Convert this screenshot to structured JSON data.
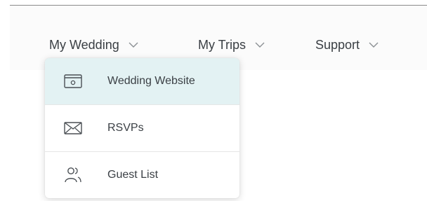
{
  "nav": {
    "items": [
      {
        "label": "My Wedding",
        "icon": "chevron-down-icon"
      },
      {
        "label": "My Trips",
        "icon": "chevron-down-icon"
      },
      {
        "label": "Support",
        "icon": "chevron-down-icon"
      }
    ]
  },
  "dropdown": {
    "items": [
      {
        "label": "Wedding Website",
        "icon": "website-window-icon",
        "active": true
      },
      {
        "label": "RSVPs",
        "icon": "envelope-icon",
        "active": false
      },
      {
        "label": "Guest List",
        "icon": "guests-icon",
        "active": false
      }
    ],
    "active_color": "#e3f2f3"
  }
}
